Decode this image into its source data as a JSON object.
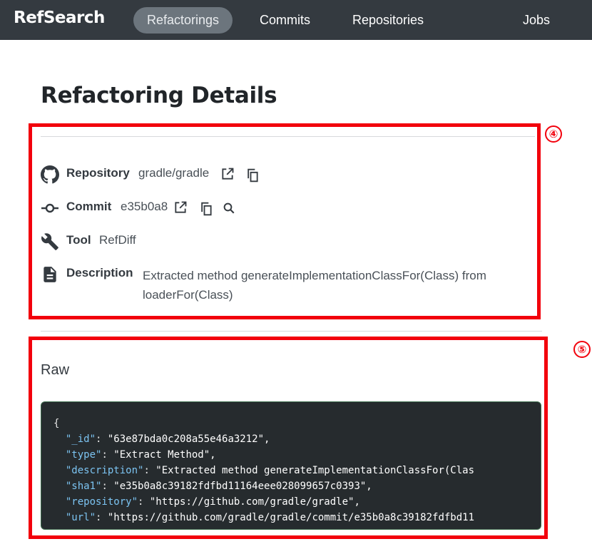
{
  "navbar": {
    "brand": "RefSearch",
    "links": [
      {
        "label": "Refactorings",
        "active": true
      },
      {
        "label": "Commits",
        "active": false
      },
      {
        "label": "Repositories",
        "active": false
      },
      {
        "label": "Jobs",
        "active": false
      }
    ],
    "bg_color": "#343a40"
  },
  "page": {
    "title": "Refactoring Details"
  },
  "annotations": [
    {
      "number": "④",
      "color": "#f2000c"
    },
    {
      "number": "⑤",
      "color": "#f2000c"
    }
  ],
  "details": {
    "repository": {
      "label": "Repository",
      "value": "gradle/gradle",
      "icons": [
        "github-icon",
        "external-link-icon",
        "copy-icon"
      ]
    },
    "commit": {
      "label": "Commit",
      "value": "e35b0a8",
      "icons": [
        "commit-icon",
        "external-link-icon",
        "copy-icon",
        "search-icon"
      ]
    },
    "tool": {
      "label": "Tool",
      "value": "RefDiff",
      "icons": [
        "wrench-icon"
      ]
    },
    "description": {
      "label": "Description",
      "value": "Extracted method generateImplementationClassFor(Class) from loaderFor(Class)",
      "icons": [
        "document-icon"
      ]
    }
  },
  "raw": {
    "title": "Raw",
    "open_brace": "{",
    "lines": [
      {
        "key": "\"_id\"",
        "value": "\"63e87bda0c208a55e46a3212\","
      },
      {
        "key": "\"type\"",
        "value": "\"Extract Method\","
      },
      {
        "key": "\"description\"",
        "value": "\"Extracted method generateImplementationClassFor(Clas"
      },
      {
        "key": "\"sha1\"",
        "value": "\"e35b0a8c39182fdfbd11164eee028099657c0393\","
      },
      {
        "key": "\"repository\"",
        "value": "\"https://github.com/gradle/gradle\","
      },
      {
        "key": "\"url\"",
        "value": "\"https://github.com/gradle/gradle/commit/e35b0a8c39182fdfbd11"
      }
    ]
  }
}
